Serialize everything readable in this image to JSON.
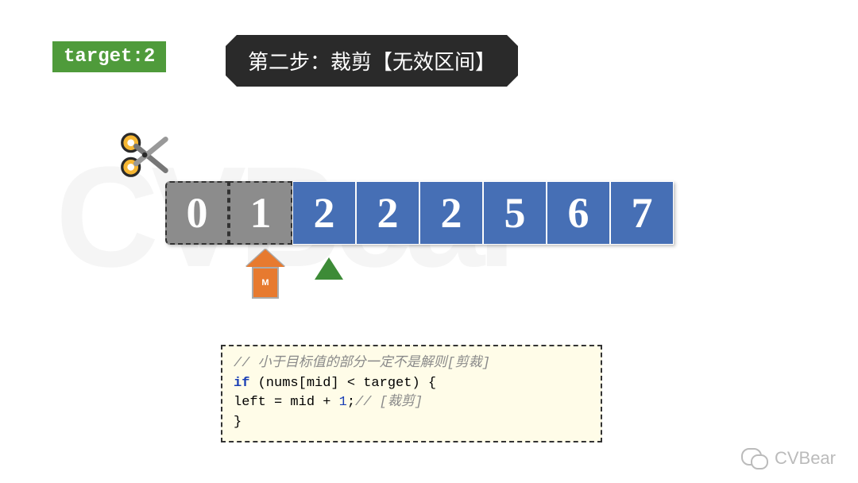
{
  "target_label": "target:2",
  "step_label": "第二步：裁剪【无效区间】",
  "watermark": "CVBear",
  "array": {
    "cells": [
      "0",
      "1",
      "2",
      "2",
      "2",
      "5",
      "6",
      "7"
    ],
    "cut_count": 2,
    "mid_index": 1,
    "left_index": 2,
    "mid_marker": "M"
  },
  "code": {
    "c1": "// 小于目标值的部分一定不是解则[剪裁]",
    "kw_if": "if",
    "cond_open": " (nums[mid] < target) {",
    "assign_pre": "    left = mid + ",
    "one": "1",
    "assign_post": ";",
    "c2": "// [裁剪]",
    "brace": "}"
  },
  "footer": "CVBear"
}
